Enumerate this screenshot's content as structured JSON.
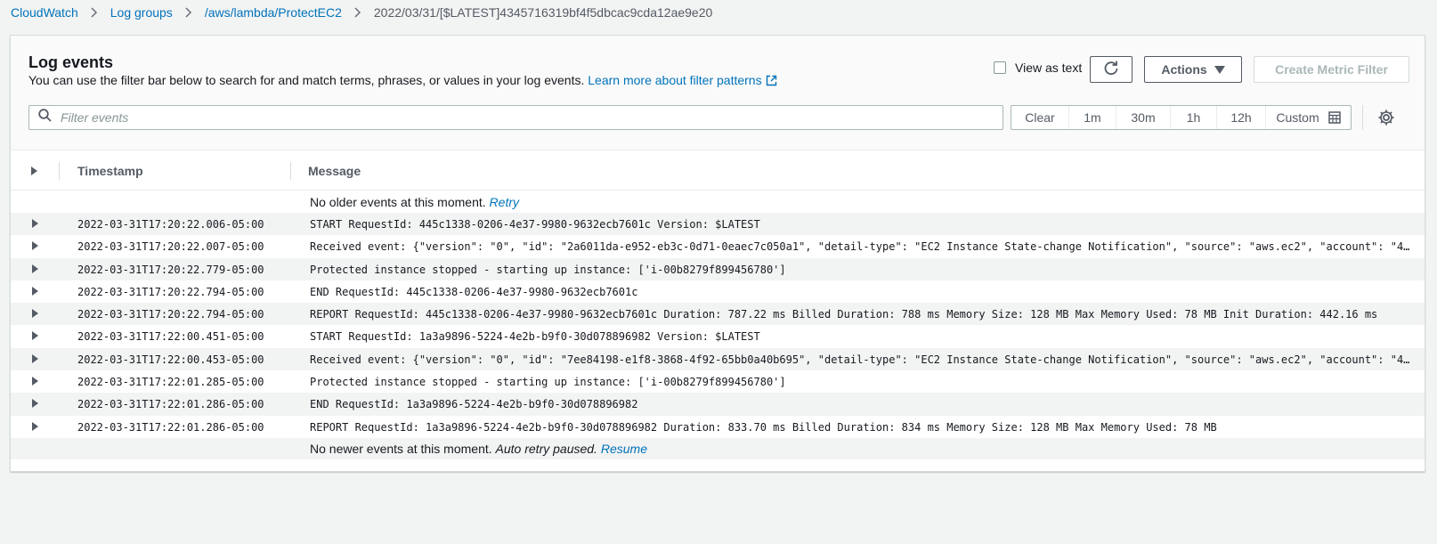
{
  "breadcrumb": {
    "items": [
      "CloudWatch",
      "Log groups",
      "/aws/lambda/ProtectEC2"
    ],
    "current": "2022/03/31/[$LATEST]4345716319bf4f5dbcac9cda12ae9e20"
  },
  "panel": {
    "title": "Log events",
    "description": "You can use the filter bar below to search for and match terms, phrases, or values in your log events.",
    "learn_more": "Learn more about filter patterns",
    "view_as_text": "View as text",
    "actions_label": "Actions",
    "create_metric_filter": "Create Metric Filter",
    "filter_placeholder": "Filter events",
    "time_ranges": [
      "Clear",
      "1m",
      "30m",
      "1h",
      "12h"
    ],
    "custom_label": "Custom"
  },
  "table": {
    "col_timestamp": "Timestamp",
    "col_message": "Message",
    "top_notice": "No older events at this moment.",
    "top_retry": "Retry",
    "bottom_notice": "No newer events at this moment.",
    "bottom_paused": "Auto retry paused.",
    "bottom_resume": "Resume",
    "rows": [
      {
        "ts": "2022-03-31T17:20:22.006-05:00",
        "msg": "START RequestId: 445c1338-0206-4e37-9980-9632ecb7601c Version: $LATEST"
      },
      {
        "ts": "2022-03-31T17:20:22.007-05:00",
        "msg": "Received event: {\"version\": \"0\", \"id\": \"2a6011da-e952-eb3c-0d71-0eaec7c050a1\", \"detail-type\": \"EC2 Instance State-change Notification\", \"source\": \"aws.ec2\", \"account\": \"4…"
      },
      {
        "ts": "2022-03-31T17:20:22.779-05:00",
        "msg": "Protected instance stopped - starting up instance: ['i-00b8279f899456780']"
      },
      {
        "ts": "2022-03-31T17:20:22.794-05:00",
        "msg": "END RequestId: 445c1338-0206-4e37-9980-9632ecb7601c"
      },
      {
        "ts": "2022-03-31T17:20:22.794-05:00",
        "msg": "REPORT RequestId: 445c1338-0206-4e37-9980-9632ecb7601c Duration: 787.22 ms Billed Duration: 788 ms Memory Size: 128 MB Max Memory Used: 78 MB Init Duration: 442.16 ms"
      },
      {
        "ts": "2022-03-31T17:22:00.451-05:00",
        "msg": "START RequestId: 1a3a9896-5224-4e2b-b9f0-30d078896982 Version: $LATEST"
      },
      {
        "ts": "2022-03-31T17:22:00.453-05:00",
        "msg": "Received event: {\"version\": \"0\", \"id\": \"7ee84198-e1f8-3868-4f92-65bb0a40b695\", \"detail-type\": \"EC2 Instance State-change Notification\", \"source\": \"aws.ec2\", \"account\": \"4…"
      },
      {
        "ts": "2022-03-31T17:22:01.285-05:00",
        "msg": "Protected instance stopped - starting up instance: ['i-00b8279f899456780']"
      },
      {
        "ts": "2022-03-31T17:22:01.286-05:00",
        "msg": "END RequestId: 1a3a9896-5224-4e2b-b9f0-30d078896982"
      },
      {
        "ts": "2022-03-31T17:22:01.286-05:00",
        "msg": "REPORT RequestId: 1a3a9896-5224-4e2b-b9f0-30d078896982 Duration: 833.70 ms Billed Duration: 834 ms Memory Size: 128 MB Max Memory Used: 78 MB"
      }
    ]
  },
  "colors": {
    "link": "#0073bb",
    "text": "#16191f",
    "muted": "#545b64",
    "row_alt": "#f2f3f3"
  }
}
